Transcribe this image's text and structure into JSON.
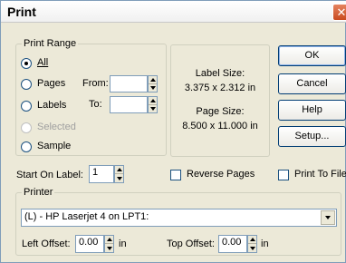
{
  "window": {
    "title": "Print",
    "close_glyph": "✕"
  },
  "print_range": {
    "legend": "Print Range",
    "options": [
      {
        "label": "All",
        "selected": true,
        "enabled": true
      },
      {
        "label": "Pages",
        "selected": false,
        "enabled": true
      },
      {
        "label": "Labels",
        "selected": false,
        "enabled": true
      },
      {
        "label": "Selected",
        "selected": false,
        "enabled": false
      },
      {
        "label": "Sample",
        "selected": false,
        "enabled": true
      }
    ],
    "from_label": "From:",
    "to_label": "To:",
    "from_value": "",
    "to_value": ""
  },
  "info": {
    "label_size_title": "Label Size:",
    "label_size_value": "3.375 x 2.312 in",
    "page_size_title": "Page Size:",
    "page_size_value": "8.500 x 11.000 in"
  },
  "buttons": {
    "ok": "OK",
    "cancel": "Cancel",
    "help": "Help",
    "setup": "Setup..."
  },
  "start_on_label": {
    "label": "Start On Label:",
    "value": "1"
  },
  "reverse_pages": {
    "label": "Reverse Pages",
    "checked": false
  },
  "print_to_file": {
    "label": "Print To File",
    "checked": false
  },
  "printer": {
    "legend": "Printer",
    "selected": "(L) - HP Laserjet 4 on LPT1:",
    "left_offset_label": "Left Offset:",
    "left_offset_value": "0.00",
    "left_offset_unit": "in",
    "top_offset_label": "Top Offset:",
    "top_offset_value": "0.00",
    "top_offset_unit": "in"
  },
  "icons": {
    "close": "close-icon",
    "spin": "spin-arrows-icon",
    "dropdown": "chevron-down-icon"
  }
}
